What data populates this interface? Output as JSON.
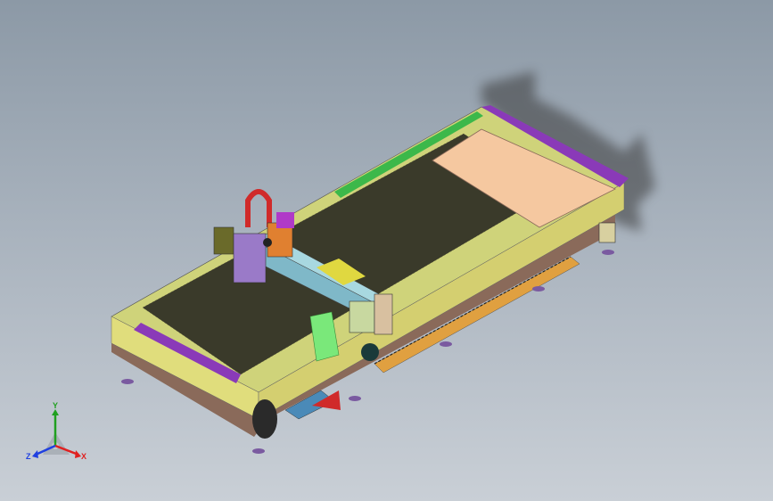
{
  "viewport": {
    "background_top": "#8c99a6",
    "background_bottom": "#c9cfd6"
  },
  "model": {
    "subject": "laser-cutting-machine",
    "colors": {
      "bed_frame": "#d8d87a",
      "bed_grid": "#3a3a2a",
      "gantry_blue": "#7fb8c8",
      "purple": "#8a3ab8",
      "green": "#3cb84a",
      "peach": "#f5c8a0",
      "red": "#d02a2a",
      "dark_base": "#8a6a5a",
      "feet": "#7a5aa0"
    }
  },
  "triad": {
    "x_label": "X",
    "y_label": "Y",
    "z_label": "Z",
    "x_color": "#e02020",
    "y_color": "#20a020",
    "z_color": "#2040e0"
  }
}
